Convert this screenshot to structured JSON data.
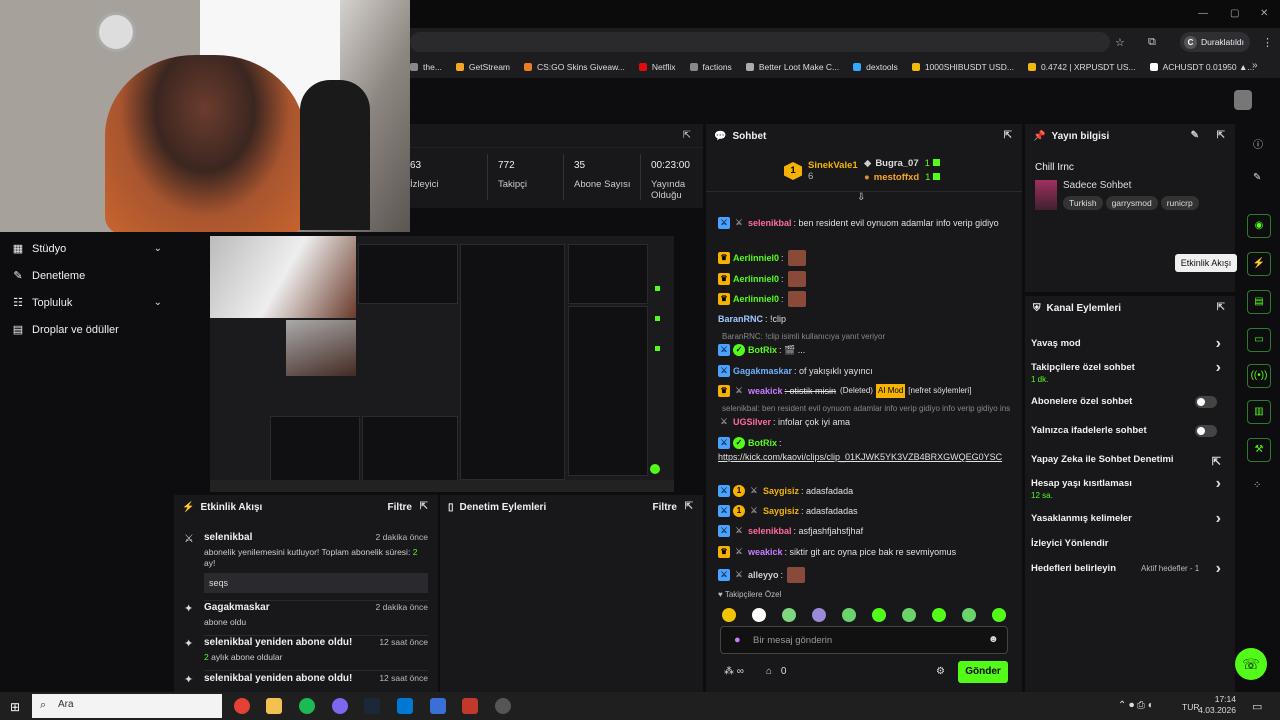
{
  "browser": {
    "profile_label": "Duraklatıldı",
    "profile_initial": "C",
    "bookmarks": [
      {
        "label": "the...",
        "color": "#888888"
      },
      {
        "label": "GetStream",
        "color": "#f5a623"
      },
      {
        "label": "CS:GO Skins Giveaw...",
        "color": "#e67e22"
      },
      {
        "label": "Netflix",
        "color": "#e50914"
      },
      {
        "label": "factions",
        "color": "#888888"
      },
      {
        "label": "Better Loot Make C...",
        "color": "#aaaaaa"
      },
      {
        "label": "dextools",
        "color": "#33aaff"
      },
      {
        "label": "1000SHIBUSDT USD...",
        "color": "#f0b90b"
      },
      {
        "label": "0.4742 | XRPUSDT US...",
        "color": "#f0b90b"
      },
      {
        "label": "ACHUSDT 0.01950 ▲...",
        "color": "#ffffff"
      }
    ]
  },
  "nav": {
    "items": [
      {
        "label": "Stüdyo",
        "icon": "▦",
        "chevron": true
      },
      {
        "label": "Denetleme",
        "icon": "✎",
        "chevron": false
      },
      {
        "label": "Topluluk",
        "icon": "☷",
        "chevron": true
      },
      {
        "label": "Droplar ve ödüller",
        "icon": "▤",
        "chevron": false
      }
    ]
  },
  "stats": {
    "items": [
      {
        "value": "63",
        "label": "İzleyici"
      },
      {
        "value": "772",
        "label": "Takipçi"
      },
      {
        "value": "35",
        "label": "Abone Sayısı"
      },
      {
        "value": "00:23:00",
        "label": "Yayında Olduğu"
      }
    ]
  },
  "activity": {
    "title": "Etkinlik Akışı",
    "filter": "Filtre",
    "events": [
      {
        "title": "selenikbal",
        "time": "2 dakika önce",
        "desc": "abonelik yenilemesini kutluyor! Toplam abonelik süresi: ",
        "highlight": "2",
        "desc2": " ay!",
        "box": "seqs"
      },
      {
        "title": "Gagakmaskar",
        "time": "2 dakika önce",
        "desc": "abone oldu"
      },
      {
        "title": "selenikbal yeniden abone oldu!",
        "time": "12 saat önce",
        "highlight": "2",
        "desc": " aylık abone oldular"
      },
      {
        "title": "selenikbal yeniden abone oldu!",
        "time": "12 saat önce"
      }
    ]
  },
  "mod_actions": {
    "title": "Denetim Eylemleri",
    "filter": "Filtre"
  },
  "chat": {
    "title": "Sohbet",
    "pinned": [
      {
        "user": "SinekVale1",
        "count": "6"
      },
      {
        "user": "Bugra_07",
        "count": "1"
      },
      {
        "user": "mestoffxd",
        "count": "1"
      }
    ],
    "messages": [
      {
        "user": "selenikbal",
        "color": "#ff6b9d",
        "text": ": ben resident evil oynuom adamlar info verip gidiyo"
      },
      {
        "user": "Aerlinniel0",
        "color": "#53fc18",
        "text": ":",
        "emote": true
      },
      {
        "user": "Aerlinniel0",
        "color": "#53fc18",
        "text": ":",
        "emote": true
      },
      {
        "user": "Aerlinniel0",
        "color": "#53fc18",
        "text": ":",
        "emote": true
      },
      {
        "user": "BaranRNC",
        "color": "#9ecbff",
        "text": ": !clip"
      },
      {
        "reply": "BaranRNC: !clip isimli kullanıcıya yanıt veriyor"
      },
      {
        "user": "BotRix",
        "color": "#53fc18",
        "text": ": 🎬 ..."
      },
      {
        "user": "Gagakmaskar",
        "color": "#6fb2ff",
        "text": ": of yakışıklı yayıncı"
      },
      {
        "user": "weakick",
        "color": "#c77dff",
        "text": ": otistik misin",
        "deleted": "(Deleted)",
        "ai": "AI Mod",
        "note": "[nefret söylemleri]"
      },
      {
        "reply": "selenikbal: ben resident evil oynuom adamlar info verip gidiyo info verip gidiyo ins info..."
      },
      {
        "user": "UGSilver",
        "color": "#ff6b9d",
        "text": ": infolar çok iyi ama"
      },
      {
        "user": "BotRix",
        "color": "#53fc18",
        "text": ":"
      },
      {
        "link": "https://kick.com/kaovi/clips/clip_01KJWK5YK3VZB4BRXGWQEG0YSC"
      },
      {
        "user": "Saygisiz",
        "color": "#f5b300",
        "text": ": adasfadada"
      },
      {
        "user": "Saygisiz",
        "color": "#f5b300",
        "text": ": adasfadadas"
      },
      {
        "user": "selenikbal",
        "color": "#ff6b9d",
        "text": ": asfjashfjahsfjhaf"
      },
      {
        "user": "weakick",
        "color": "#c77dff",
        "text": ": siktir git arc oyna pice bak re sevmiyomus"
      },
      {
        "user": "alleyyo",
        "color": "#cfcfcf",
        "text": ":",
        "emote": true
      }
    ],
    "follower_label": "Takipçilere Özel",
    "input_placeholder": "Bir mesaj gönderin",
    "infinity": "∞",
    "zero": "0",
    "send_label": "Gönder",
    "accent": "#53fc18"
  },
  "stream_info": {
    "title": "Yayın bilgisi",
    "stream_title": "Chill Irnc",
    "category": "Sadece Sohbet",
    "tags": [
      "Turkish",
      "garrysmod",
      "runicrp"
    ]
  },
  "channel_actions": {
    "title": "Kanal Eylemleri",
    "rows": [
      {
        "label": "Yavaş mod",
        "control": "arrow"
      },
      {
        "label": "Takipçilere özel sohbet",
        "sub": "1 dk.",
        "control": "arrow"
      },
      {
        "label": "Abonelere özel sohbet",
        "control": "toggle"
      },
      {
        "label": "Yalnızca ifadelerle sohbet",
        "control": "toggle"
      },
      {
        "label": "Yapay Zeka ile Sohbet Denetimi",
        "control": "external"
      },
      {
        "label": "Hesap yaşı kısıtlaması",
        "sub": "12 sa.",
        "control": "arrow"
      },
      {
        "label": "Yasaklanmış kelimeler",
        "control": "arrow"
      },
      {
        "label": "İzleyici Yönlendir",
        "control": "none"
      },
      {
        "label": "Hedefleri belirleyin",
        "sub2": "Aktif hedefler - 1",
        "control": "arrow"
      }
    ]
  },
  "rail": {
    "tooltip": "Etkinlik Akışı"
  },
  "taskbar": {
    "search": "Ara",
    "lang": "TUR",
    "time": "17:14",
    "date": "4.03.2026"
  }
}
